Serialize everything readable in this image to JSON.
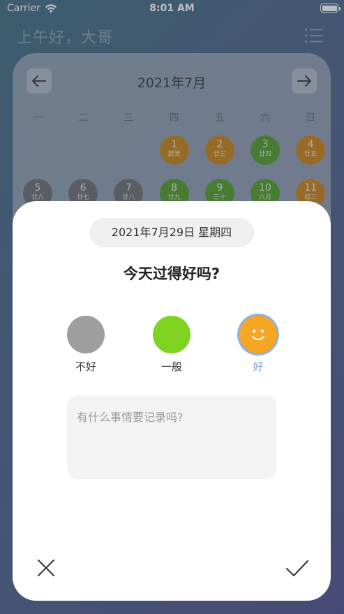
{
  "status_bar": {
    "carrier": "Carrier",
    "time": "8:01 AM"
  },
  "header": {
    "greeting": "上午好，大哥"
  },
  "calendar": {
    "title": "2021年7月",
    "weekdays": [
      "一",
      "二",
      "三",
      "四",
      "五",
      "六",
      "日"
    ],
    "days": [
      {
        "num": "1",
        "lunar": "建党",
        "col": 3,
        "row": 0,
        "color": "#c7800f"
      },
      {
        "num": "2",
        "lunar": "廿三",
        "col": 4,
        "row": 0,
        "color": "#c7800f"
      },
      {
        "num": "3",
        "lunar": "廿四",
        "col": 5,
        "row": 0,
        "color": "#4f9a1f"
      },
      {
        "num": "4",
        "lunar": "廿五",
        "col": 6,
        "row": 0,
        "color": "#c7800f"
      },
      {
        "num": "5",
        "lunar": "廿六",
        "col": 0,
        "row": 1,
        "color": "#6b6b6b"
      },
      {
        "num": "6",
        "lunar": "廿七",
        "col": 1,
        "row": 1,
        "color": "#6b6b6b"
      },
      {
        "num": "7",
        "lunar": "廿八",
        "col": 2,
        "row": 1,
        "color": "#6b6b6b"
      },
      {
        "num": "8",
        "lunar": "廿九",
        "col": 3,
        "row": 1,
        "color": "#4f9a1f"
      },
      {
        "num": "9",
        "lunar": "三十",
        "col": 4,
        "row": 1,
        "color": "#4f9a1f"
      },
      {
        "num": "10",
        "lunar": "六月",
        "col": 5,
        "row": 1,
        "color": "#4f9a1f"
      },
      {
        "num": "11",
        "lunar": "初二",
        "col": 6,
        "row": 1,
        "color": "#c7800f"
      }
    ]
  },
  "modal": {
    "date": "2021年7月29日  星期四",
    "question": "今天过得好吗?",
    "moods": [
      {
        "label": "不好",
        "color": "#9e9e9e",
        "selected": false
      },
      {
        "label": "一般",
        "color": "#7ed321",
        "selected": false
      },
      {
        "label": "好",
        "color": "#f5a623",
        "selected": true
      }
    ],
    "note_placeholder": "有什么事情要记录吗?",
    "note_value": ""
  }
}
